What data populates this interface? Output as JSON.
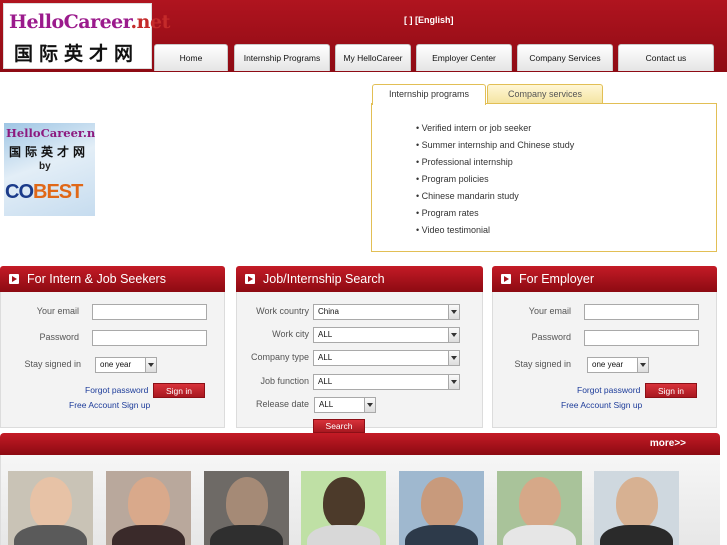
{
  "header": {
    "logo_text": "HelloCareer",
    "logo_dot": ".net",
    "logo_cn": "国际英才网",
    "language_switch": "[    ] [English]"
  },
  "nav": {
    "items": [
      {
        "label": "Home"
      },
      {
        "label": "Internship Programs"
      },
      {
        "label": "My HelloCareer"
      },
      {
        "label": "Employer Center"
      },
      {
        "label": "Company Services"
      },
      {
        "label": "Contact us"
      }
    ]
  },
  "side_logo": {
    "text_en": "HelloCareer.net",
    "text_cn": "国际英才网",
    "by": "by",
    "brand_a": "CO",
    "brand_b": "BEST"
  },
  "tabs": {
    "items": [
      {
        "label": "Internship programs",
        "active": true
      },
      {
        "label": "Company services",
        "active": false
      }
    ],
    "list": [
      "• Verified intern or job seeker",
      "• Summer internship and Chinese study",
      "• Professional internship",
      "• Program policies",
      "• Chinese mandarin study",
      "• Program rates",
      "• Video testimonial"
    ]
  },
  "seekers": {
    "title": "For Intern & Job Seekers",
    "email_label": "Your email",
    "password_label": "Password",
    "stay_label": "Stay signed in",
    "stay_value": "one year",
    "forgot": "Forgot password",
    "signin": "Sign in",
    "signup": "Free Account Sign up"
  },
  "search": {
    "title": "Job/Internship Search",
    "fields": [
      {
        "label": "Work country",
        "value": "China"
      },
      {
        "label": "Work city",
        "value": "ALL"
      },
      {
        "label": "Company type",
        "value": "ALL"
      },
      {
        "label": "Job function",
        "value": "ALL"
      },
      {
        "label": "Release date",
        "value": "ALL"
      }
    ],
    "button": "Search"
  },
  "employer": {
    "title": "For Employer",
    "email_label": "Your email",
    "password_label": "Password",
    "stay_label": "Stay signed in",
    "stay_value": "one year",
    "forgot": "Forgot password",
    "signin": "Sign in",
    "signup": "Free Account Sign up"
  },
  "more": {
    "label": "more>>"
  },
  "colors": {
    "brand_red": "#a5121b",
    "link_blue": "#1d3c9a",
    "tab_border": "#e2bf55",
    "logo_purple": "#9b1a8c"
  }
}
